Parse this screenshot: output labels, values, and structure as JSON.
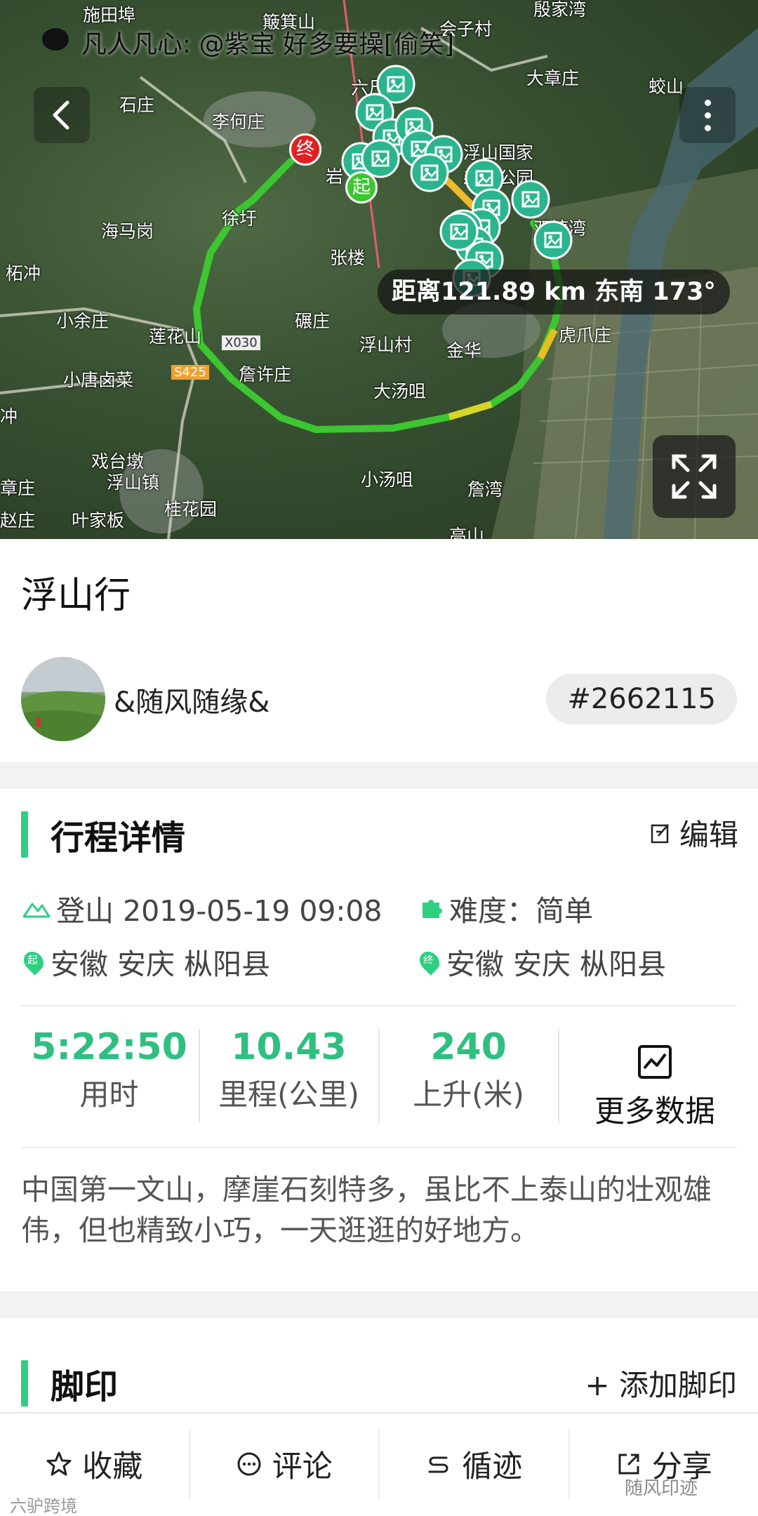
{
  "notification": {
    "text": "凡人凡心: @紫宝 好多要操[偷笑]"
  },
  "map": {
    "labels": [
      "施田埠",
      "簸箕山",
      "会子村",
      "殷家湾",
      "大章庄",
      "蛟山",
      "石庄",
      "李何庄",
      "六尺脚",
      "浮山国家森林公园",
      "海马岗",
      "徐圩",
      "岩",
      "柘冲",
      "张楼",
      "双塘湾",
      "小余庄",
      "碾庄",
      "莲花山",
      "X030",
      "浮山村",
      "金华",
      "虎爪庄",
      "小唐卤菜",
      "S425",
      "詹许庄",
      "大汤咀",
      "冲",
      "戏台墩",
      "浮山镇",
      "小汤咀",
      "詹湾",
      "章庄",
      "赵庄",
      "叶家板",
      "桂花园",
      "高山"
    ],
    "start_marker": "起",
    "end_marker": "终",
    "distance_text": "距离121.89 km 东南 173°",
    "route_color": "#3cc630"
  },
  "trip": {
    "title": "浮山行",
    "user_name": "&随风随缘&",
    "track_id": "#2662115"
  },
  "detail": {
    "section_title": "行程详情",
    "edit_label": "编辑",
    "activity": "登山 2019-05-19 09:08",
    "difficulty": "难度：简单",
    "start_location": "安徽 安庆 枞阳县",
    "end_location": "安徽 安庆 枞阳县",
    "start_badge": "起",
    "end_badge": "终",
    "stats": [
      {
        "value": "5:22:50",
        "label": "用时"
      },
      {
        "value": "10.43",
        "label": "里程(公里)"
      },
      {
        "value": "240",
        "label": "上升(米)"
      }
    ],
    "more_data_label": "更多数据",
    "description": "中国第一文山，摩崖石刻特多，虽比不上泰山的壮观雄伟，但也精致小巧，一天逛逛的好地方。"
  },
  "footprint": {
    "section_title": "脚印",
    "add_label": "+ 添加脚印"
  },
  "bottom_bar": {
    "favorite": "收藏",
    "comment": "评论",
    "follow_track": "循迹",
    "share": "分享"
  },
  "watermarks": {
    "left": "六驴跨境",
    "right": "随风印迹"
  },
  "colors": {
    "accent": "#2fcf82",
    "stat_value": "#2fbf80",
    "marker_photo": "#2ab58f",
    "end_marker": "#e02020"
  }
}
